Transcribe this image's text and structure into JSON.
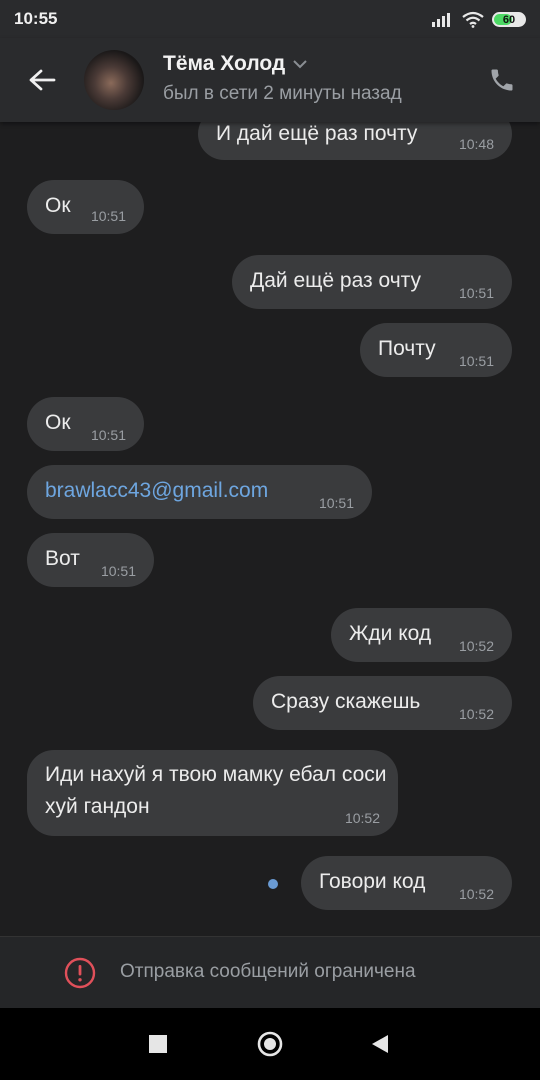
{
  "status_bar": {
    "time": "10:55",
    "battery_level": "60",
    "battery_color": "#4cd964"
  },
  "header": {
    "name": "Тёма Холод",
    "status": "был в сети 2 минуты назад"
  },
  "messages": [
    {
      "side": "out",
      "text": "И дай ещё раз почту",
      "time": "10:48"
    },
    {
      "side": "in",
      "text": "Ок",
      "time": "10:51"
    },
    {
      "side": "out",
      "text": "Дай ещё раз очту",
      "time": "10:51"
    },
    {
      "side": "out",
      "text": "Почту",
      "time": "10:51"
    },
    {
      "side": "in",
      "text": "Ок",
      "time": "10:51"
    },
    {
      "side": "in",
      "text": "brawlacc43@gmail.com",
      "time": "10:51",
      "link": true
    },
    {
      "side": "in",
      "text": "Вот",
      "time": "10:51"
    },
    {
      "side": "out",
      "text": "Жди код",
      "time": "10:52"
    },
    {
      "side": "out",
      "text": "Сразу скажешь",
      "time": "10:52"
    },
    {
      "side": "in",
      "text": "Иди нахуй я твою мамку ебал соси хуй гандон",
      "time": "10:52"
    },
    {
      "side": "out",
      "text": "Говори код",
      "time": "10:52",
      "unread": true
    }
  ],
  "restriction": {
    "text": "Отправка сообщений ограничена",
    "icon_color": "#e0505a"
  },
  "colors": {
    "bubble": "#3a3b3d",
    "link": "#6ea6e0",
    "unread_dot": "#6a9bd3"
  }
}
